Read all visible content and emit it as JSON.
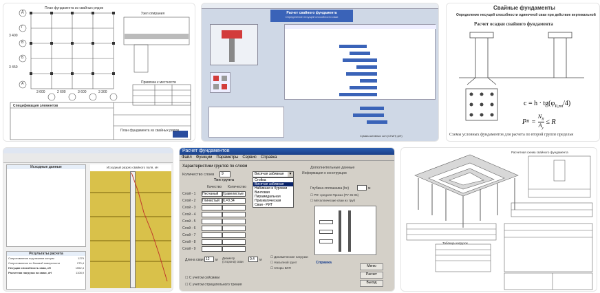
{
  "tiles": [
    {
      "title": "План фундамента из свайных рядов",
      "label_section": "Узел опирания",
      "label_spec": "Спецификация элементов",
      "label_bind": "Привязка к местности",
      "label_stamp": "План фундамента из свайных рядов",
      "row_labels": [
        "Д",
        "Г",
        "В",
        "Б",
        "А"
      ],
      "dims": [
        "3 600",
        "2 600",
        "3 600",
        "3 300",
        "3 400",
        "3 450"
      ]
    },
    {
      "title": "Расчет свайного фундамента",
      "subtitle": "Определение несущей способности сваи",
      "footer": "Сумма активных сил (СНиП) (кН)"
    },
    {
      "title": "Свайные фундаменты",
      "line1": "Определение несущей способности одиночной сваи при действие вертикальной",
      "line2": "Расчет осадки свайного фундамента",
      "formula1": "c = h · tg(φ",
      "formula1_sub": "II,mt",
      "formula1_end": "/4)",
      "formula2_lhs": "P",
      "formula2_sub": "II",
      "formula2_rhs": "N",
      "formula2_den": "A",
      "formula2_den_sub": "y",
      "formula2_tail": "≤ R",
      "caption": "Схемы условных фундаментов для расчета по второй группе предельн"
    },
    {
      "title": "Исходные данные",
      "chart_title": "Исходный разрез свайного поля, кН",
      "results_title": "Результаты расчета",
      "results": [
        {
          "label": "Сопротивление под нижним концом",
          "value": "1279"
        },
        {
          "label": "Сопротивление по боковой поверхности",
          "value": "273,4"
        },
        {
          "label": "Несущая способность сваи, кН",
          "value": "1552,4"
        },
        {
          "label": "Расчетная нагрузка на сваю, кН",
          "value": "1108,9"
        }
      ]
    },
    {
      "window_title": "Расчет фундаментов",
      "menu": [
        "Файл",
        "Функции",
        "Параметры",
        "Сервис",
        "Справка"
      ],
      "group_title": "Характеристики грунтов по слоям",
      "count_label": "Количество слоев",
      "count_value": "9",
      "soil_type_label": "Тип грунта",
      "soil_selected": "Висячая забивная",
      "col_quality": "Качество",
      "col_count": "Количество",
      "layers": [
        {
          "name": "Слой - 1",
          "q": "Песчаный",
          "t": "Гравелистые"
        },
        {
          "name": "Слой - 2",
          "q": "Глинистый",
          "t": "IL=0.34"
        },
        {
          "name": "Слой - 3",
          "q": "",
          "t": ""
        },
        {
          "name": "Слой - 4",
          "q": "",
          "t": ""
        },
        {
          "name": "Слой - 5",
          "q": "",
          "t": ""
        },
        {
          "name": "Слой - 6",
          "q": "",
          "t": ""
        },
        {
          "name": "Слой - 7",
          "q": "",
          "t": ""
        },
        {
          "name": "Слой - 8",
          "q": "",
          "t": ""
        },
        {
          "name": "Слой - 9",
          "q": "",
          "t": ""
        }
      ],
      "dropdown_items": [
        "Стойка",
        "Висячая забивная",
        "Набивная и буровая",
        "Винтовая",
        "Пирамидальная",
        "Призматическая",
        "Сваи - РИТ"
      ],
      "extra_title": "Дополнительные данные",
      "info_title": "Информация о конструкции",
      "depth_label": "Глубина сплошника (hс)",
      "depth_unit": "м",
      "check1": "РФ: средняя Приказ (РУ 35-05)",
      "check2": "Металлические сваи из труб",
      "pile_len_label": "Длина сваи",
      "pile_len_value": "12",
      "pile_len_unit": "м",
      "diam_label": "Диаметр (сторона) сваи",
      "diam_value": "0.4",
      "diam_unit": "м",
      "dyn_load": "Динамические нагрузки",
      "bulk_soil": "Насыпной грунт",
      "vlp": "Опоры ВЛП",
      "seismic": "С учетом сейсмики",
      "neg_friction": "С учетом отрицательного трения",
      "help_label": "Справка",
      "btn_menu": "Меню",
      "btn_calc": "Расчет",
      "btn_exit": "Выход"
    },
    {
      "title": "Расчетная схема свайного фундамента",
      "table_caption": "Таблица нагрузок"
    }
  ],
  "colors": {
    "blueprint_line": "#555555",
    "sheet_blue": "#3a63b8",
    "win_title": "#2a5db0",
    "soil_yellow": "#d9c14a",
    "chart_line": "#c0392b"
  }
}
